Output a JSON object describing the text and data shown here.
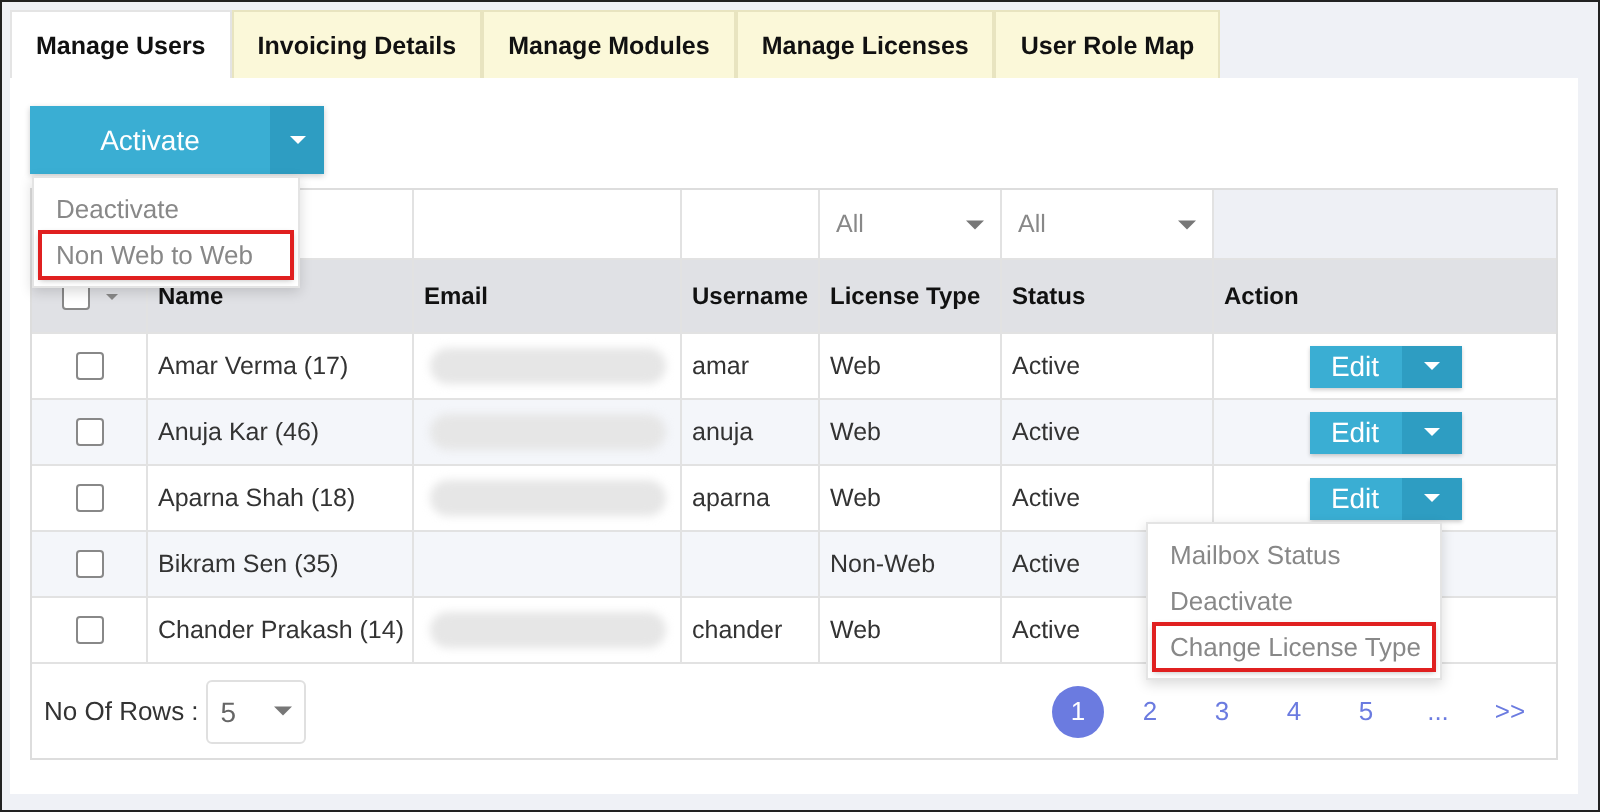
{
  "tabs": [
    {
      "label": "Manage Users",
      "selected": true
    },
    {
      "label": "Invoicing Details",
      "selected": false
    },
    {
      "label": "Manage Modules",
      "selected": false
    },
    {
      "label": "Manage Licenses",
      "selected": false
    },
    {
      "label": "User Role Map",
      "selected": false
    }
  ],
  "bulk_action": {
    "label": "Activate",
    "menu": [
      {
        "label": "Deactivate",
        "highlighted": false
      },
      {
        "label": "Non Web to Web",
        "highlighted": true
      }
    ]
  },
  "table": {
    "filters": [
      {
        "kind": "text"
      },
      {
        "kind": "text"
      },
      {
        "kind": "text"
      },
      {
        "kind": "select",
        "value": "All"
      },
      {
        "kind": "select",
        "value": "All"
      },
      {
        "kind": "blank"
      }
    ],
    "header_checkbox": {
      "checked": false
    },
    "columns": [
      "Name",
      "Email",
      "Username",
      "License Type",
      "Status",
      "Action"
    ],
    "rows": [
      {
        "checked": false,
        "name": "Amar Verma (17)",
        "email_redacted": true,
        "username": "amar",
        "license_type": "Web",
        "status": "Active",
        "action": "Edit"
      },
      {
        "checked": false,
        "name": "Anuja Kar (46)",
        "email_redacted": true,
        "username": "anuja",
        "license_type": "Web",
        "status": "Active",
        "action": "Edit"
      },
      {
        "checked": false,
        "name": "Aparna Shah (18)",
        "email_redacted": true,
        "username": "aparna",
        "license_type": "Web",
        "status": "Active",
        "action": "Edit"
      },
      {
        "checked": false,
        "name": "Bikram Sen (35)",
        "email_redacted": false,
        "license_type": "Non-Web",
        "status": "Active"
      },
      {
        "checked": false,
        "name": "Chander Prakash (14)",
        "email_redacted": true,
        "username": "chander",
        "license_type": "Web",
        "status": "Active"
      }
    ],
    "row_menu": [
      {
        "label": "Mailbox Status",
        "highlighted": false
      },
      {
        "label": "Deactivate",
        "highlighted": false
      },
      {
        "label": "Change License Type",
        "highlighted": true
      }
    ]
  },
  "rows_per_page": {
    "label": "No Of Rows :",
    "value": "5"
  },
  "pagination": [
    {
      "label": "1",
      "selected": true
    },
    {
      "label": "2",
      "selected": false
    },
    {
      "label": "3",
      "selected": false
    },
    {
      "label": "4",
      "selected": false
    },
    {
      "label": "5",
      "selected": false
    },
    {
      "label": "...",
      "selected": false
    },
    {
      "label": ">>",
      "selected": false
    }
  ]
}
